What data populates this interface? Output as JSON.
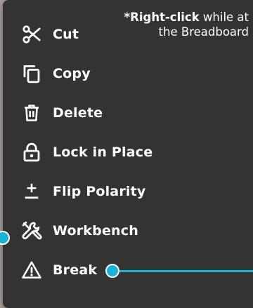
{
  "annotation": {
    "emphasis": "*Right-click",
    "line1_rest": " while at",
    "line2": "the Breadboard"
  },
  "menu": {
    "items": [
      {
        "label": "Cut",
        "icon": "scissors-icon"
      },
      {
        "label": "Copy",
        "icon": "copy-icon"
      },
      {
        "label": "Delete",
        "icon": "trash-icon"
      },
      {
        "label": "Lock in Place",
        "icon": "lock-icon"
      },
      {
        "label": "Flip Polarity",
        "icon": "plus-minus-icon"
      },
      {
        "label": "Workbench",
        "icon": "tools-icon"
      },
      {
        "label": "Break",
        "icon": "warning-icon"
      }
    ]
  },
  "colors": {
    "menu_background": "#333333",
    "text": "#ffffff",
    "callout": "#17b3d8"
  }
}
